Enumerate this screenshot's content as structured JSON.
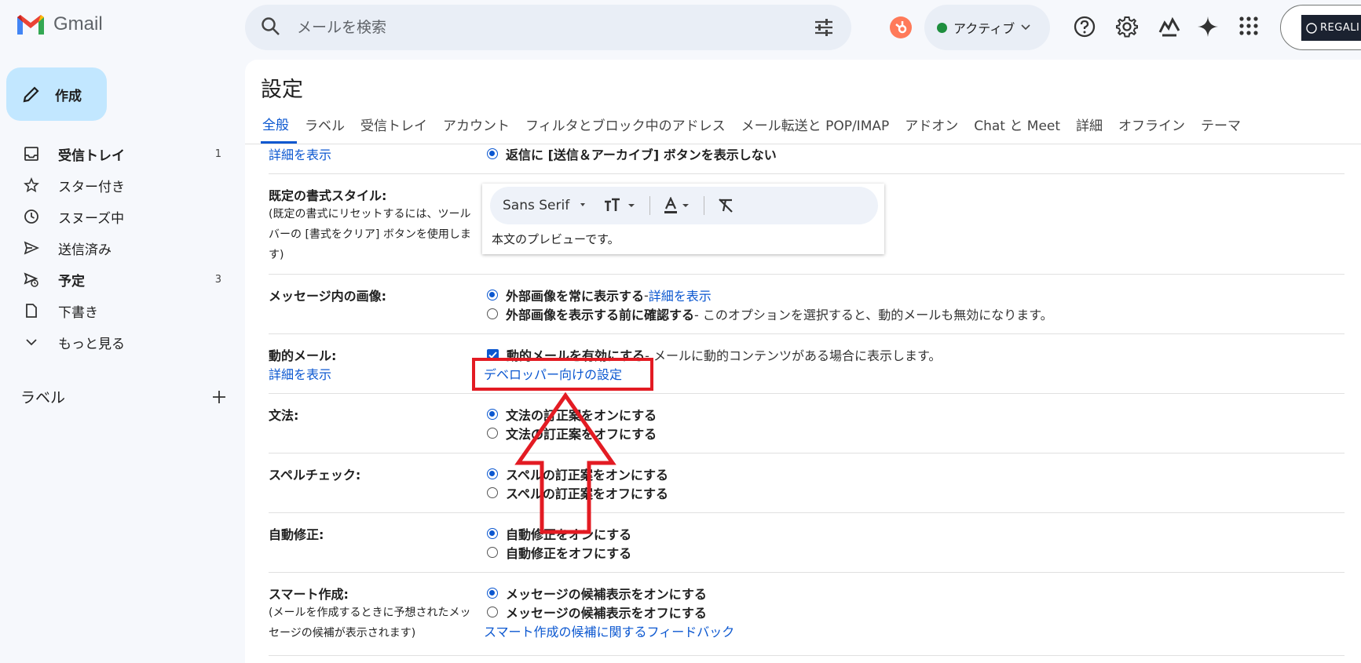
{
  "app": {
    "name": "Gmail"
  },
  "search": {
    "placeholder": "メールを検索"
  },
  "status": {
    "label": "アクティブ"
  },
  "account": {
    "org": "REGALI"
  },
  "compose": {
    "label": "作成"
  },
  "nav": {
    "items": [
      {
        "label": "受信トレイ",
        "count": "1",
        "icon": "inbox-icon"
      },
      {
        "label": "スター付き",
        "count": "",
        "icon": "star-icon"
      },
      {
        "label": "スヌーズ中",
        "count": "",
        "icon": "clock-icon"
      },
      {
        "label": "送信済み",
        "count": "",
        "icon": "send-icon"
      },
      {
        "label": "予定",
        "count": "3",
        "icon": "scheduled-icon"
      },
      {
        "label": "下書き",
        "count": "",
        "icon": "draft-icon"
      },
      {
        "label": "もっと見る",
        "count": "",
        "icon": "chevron-down-icon"
      }
    ],
    "labels_heading": "ラベル"
  },
  "settings": {
    "title": "設定",
    "tabs": [
      "全般",
      "ラベル",
      "受信トレイ",
      "アカウント",
      "フィルタとブロック中のアドレス",
      "メール転送と POP/IMAP",
      "アドオン",
      "Chat と Meet",
      "詳細",
      "オフライン",
      "テーマ"
    ],
    "top_link": "詳細を表示",
    "send_archive_option": "返信に [送信＆アーカイブ] ボタンを表示しない",
    "default_text": {
      "label": "既定の書式スタイル:",
      "note": "(既定の書式にリセットするには、ツールバーの [書式をクリア] ボタンを使用します)",
      "font": "Sans Serif",
      "preview": "本文のプレビューです。"
    },
    "images": {
      "label": "メッセージ内の画像:",
      "opt1": "外部画像を常に表示する",
      "opt1_sep": " - ",
      "opt1_link": "詳細を表示",
      "opt2": "外部画像を表示する前に確認する",
      "opt2_desc": " - このオプションを選択すると、動的メールも無効になります。"
    },
    "dynamic": {
      "label": "動的メール:",
      "link": "詳細を表示",
      "opt": "動的メールを有効にする",
      "opt_desc": " - メールに動的コンテンツがある場合に表示します。",
      "dev_link": "デベロッパー向けの設定"
    },
    "grammar": {
      "label": "文法:",
      "on": "文法の訂正案をオンにする",
      "off": "文法の訂正案をオフにする"
    },
    "spelling": {
      "label": "スペルチェック:",
      "on": "スペルの訂正案をオンにする",
      "off": "スペルの訂正案をオフにする"
    },
    "autocorrect": {
      "label": "自動修正:",
      "on": "自動修正をオンにする",
      "off": "自動修正をオフにする"
    },
    "smart_compose": {
      "label": "スマート作成:",
      "note": "(メールを作成するときに予想されたメッセージの候補が表示されます)",
      "on": "メッセージの候補表示をオンにする",
      "off": "メッセージの候補表示をオフにする",
      "feedback": "スマート作成の候補に関するフィードバック"
    }
  },
  "colors": {
    "accent": "#0b57d0",
    "annotation": "#e31b23",
    "compose_bg": "#c2e7ff"
  }
}
